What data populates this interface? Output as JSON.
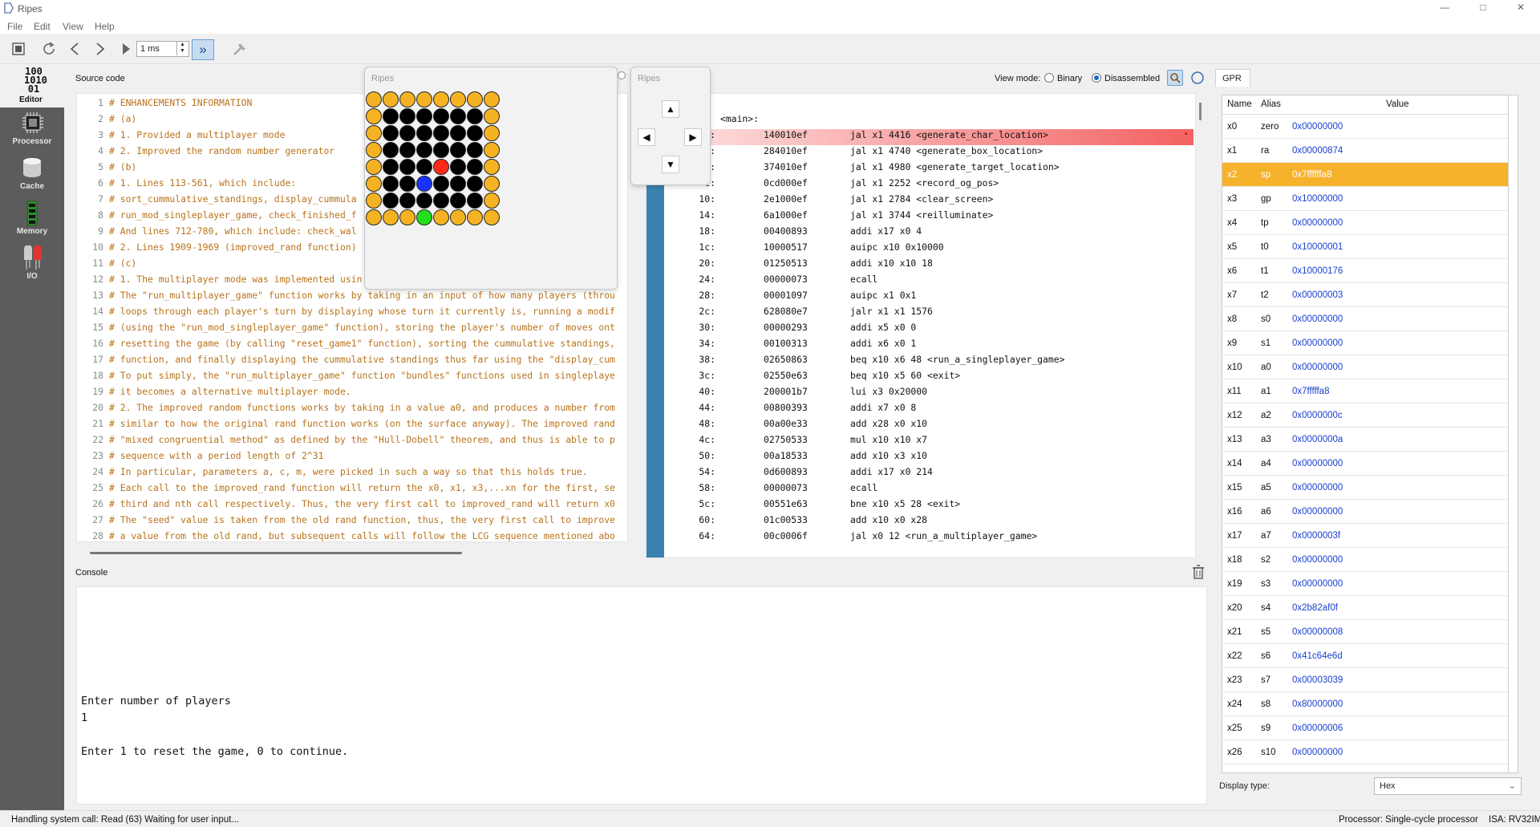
{
  "window": {
    "title": "Ripes",
    "minimize": "—",
    "maximize": "□",
    "close": "✕"
  },
  "menu": [
    "File",
    "Edit",
    "View",
    "Help"
  ],
  "toolbar": {
    "speed_value": "1 ms"
  },
  "sidebar": [
    {
      "label": "Editor",
      "icon": "editor-icon"
    },
    {
      "label": "Processor",
      "icon": "processor-icon"
    },
    {
      "label": "Cache",
      "icon": "cache-icon"
    },
    {
      "label": "Memory",
      "icon": "memory-icon"
    },
    {
      "label": "I/O",
      "icon": "io-icon"
    }
  ],
  "editor_icon_text": [
    "100",
    "1010",
    "01"
  ],
  "source_code": {
    "label": "Source code",
    "lines": [
      "# ENHANCEMENTS INFORMATION",
      "# (a)",
      "# 1. Provided a multiplayer mode",
      "# 2. Improved the random number generator",
      "# (b)",
      "# 1. Lines 113-561, which include:",
      "#  sort_cummulative_standings, display_cummula",
      "#  run_mod_singleplayer_game, check_finished_f",
      "#  And lines 712-780, which include: check_wal",
      "# 2. Lines 1909-1969 (improved_rand function)",
      "# (c)",
      "# 1. The multiplayer mode was implemented usin",
      "# The \"run_multiplayer_game\" function works by taking in an input of how many players (throu",
      "# loops through each player's turn by displaying whose turn it currently is, running a modif",
      "# (using the \"run_mod_singleplayer_game\" function), storing the player's number of moves ont",
      "# resetting the game (by calling \"reset_game1\" function), sorting the cummulative standings,",
      "# function, and finally displaying the cummulative standings thus far using the \"display_cum",
      "# To put simply, the \"run_multiplayer_game\" function \"bundles\" functions used in singleplaye",
      "# it becomes a alternative multiplayer mode.",
      "# 2. The improved random functions works by taking in a value a0, and produces a number from",
      "# similar to how the original rand function works (on the surface anyway). The improved rand",
      "# \"mixed congruential method\" as defined by the \"Hull-Dobell\" theorem, and thus is able to p",
      "# sequence with a period length of 2^31",
      "# In particular, parameters a, c, m, were picked in such a way so that this holds true.",
      "# Each call to the improved_rand function will return the x0, x1, x3,...xn for the first, se",
      "# third and nth call respectively. Thus, the very first call to improved_rand will return x0",
      "# The \"seed\" value is taken from the old rand function, thus, the very first call to improve",
      "# a value from the old rand, but subsequent calls will follow the LCG sequence mentioned abo"
    ]
  },
  "view_mode": {
    "label": "View mode:",
    "options": [
      "Binary",
      "Disassembled"
    ],
    "selected": "Disassembled"
  },
  "disassembly": {
    "header": "<main>:",
    "rows": [
      {
        "addr": "0:",
        "hex": "140010ef",
        "ins": "jal x1 4416 <generate_char_location>"
      },
      {
        "addr": "4:",
        "hex": "284010ef",
        "ins": "jal x1 4740 <generate_box_location>"
      },
      {
        "addr": "8:",
        "hex": "374010ef",
        "ins": "jal x1 4980 <generate_target_location>"
      },
      {
        "addr": "c:",
        "hex": "0cd000ef",
        "ins": "jal x1 2252 <record_og_pos>"
      },
      {
        "addr": "10:",
        "hex": "2e1000ef",
        "ins": "jal x1 2784 <clear_screen>"
      },
      {
        "addr": "14:",
        "hex": "6a1000ef",
        "ins": "jal x1 3744 <reilluminate>"
      },
      {
        "addr": "18:",
        "hex": "00400893",
        "ins": "addi x17 x0 4"
      },
      {
        "addr": "1c:",
        "hex": "10000517",
        "ins": "auipc x10 0x10000"
      },
      {
        "addr": "20:",
        "hex": "01250513",
        "ins": "addi x10 x10 18"
      },
      {
        "addr": "24:",
        "hex": "00000073",
        "ins": "ecall"
      },
      {
        "addr": "28:",
        "hex": "00001097",
        "ins": "auipc x1 0x1"
      },
      {
        "addr": "2c:",
        "hex": "628080e7",
        "ins": "jalr x1 x1 1576"
      },
      {
        "addr": "30:",
        "hex": "00000293",
        "ins": "addi x5 x0 0"
      },
      {
        "addr": "34:",
        "hex": "00100313",
        "ins": "addi x6 x0 1"
      },
      {
        "addr": "38:",
        "hex": "02650863",
        "ins": "beq x10 x6 48 <run_a_singleplayer_game>"
      },
      {
        "addr": "3c:",
        "hex": "02550e63",
        "ins": "beq x10 x5 60 <exit>"
      },
      {
        "addr": "40:",
        "hex": "200001b7",
        "ins": "lui x3 0x20000"
      },
      {
        "addr": "44:",
        "hex": "00800393",
        "ins": "addi x7 x0 8"
      },
      {
        "addr": "48:",
        "hex": "00a00e33",
        "ins": "add x28 x0 x10"
      },
      {
        "addr": "4c:",
        "hex": "02750533",
        "ins": "mul x10 x10 x7"
      },
      {
        "addr": "50:",
        "hex": "00a18533",
        "ins": "add x10 x3 x10"
      },
      {
        "addr": "54:",
        "hex": "0d600893",
        "ins": "addi x17 x0 214"
      },
      {
        "addr": "58:",
        "hex": "00000073",
        "ins": "ecall"
      },
      {
        "addr": "5c:",
        "hex": "00551e63",
        "ins": "bne x10 x5 28 <exit>"
      },
      {
        "addr": "60:",
        "hex": "01c00533",
        "ins": "add x10 x0 x28"
      },
      {
        "addr": "64:",
        "hex": "00c0006f",
        "ins": "jal x0 12 <run_a_multiplayer_game>"
      }
    ]
  },
  "console": {
    "label": "Console",
    "lines": [
      "Enter number of players",
      "1",
      "",
      "Enter 1 to reset the game, 0 to continue."
    ]
  },
  "gpr": {
    "tab": "GPR",
    "columns": [
      "Name",
      "Alias",
      "Value"
    ],
    "selected": "x2",
    "rows": [
      {
        "name": "x0",
        "alias": "zero",
        "value": "0x00000000"
      },
      {
        "name": "x1",
        "alias": "ra",
        "value": "0x00000874"
      },
      {
        "name": "x2",
        "alias": "sp",
        "value": "0x7ffffffa8"
      },
      {
        "name": "x3",
        "alias": "gp",
        "value": "0x10000000"
      },
      {
        "name": "x4",
        "alias": "tp",
        "value": "0x00000000"
      },
      {
        "name": "x5",
        "alias": "t0",
        "value": "0x10000001"
      },
      {
        "name": "x6",
        "alias": "t1",
        "value": "0x10000176"
      },
      {
        "name": "x7",
        "alias": "t2",
        "value": "0x00000003"
      },
      {
        "name": "x8",
        "alias": "s0",
        "value": "0x00000000"
      },
      {
        "name": "x9",
        "alias": "s1",
        "value": "0x00000000"
      },
      {
        "name": "x10",
        "alias": "a0",
        "value": "0x00000000"
      },
      {
        "name": "x11",
        "alias": "a1",
        "value": "0x7fffffa8"
      },
      {
        "name": "x12",
        "alias": "a2",
        "value": "0x0000000c"
      },
      {
        "name": "x13",
        "alias": "a3",
        "value": "0x0000000a"
      },
      {
        "name": "x14",
        "alias": "a4",
        "value": "0x00000000"
      },
      {
        "name": "x15",
        "alias": "a5",
        "value": "0x00000000"
      },
      {
        "name": "x16",
        "alias": "a6",
        "value": "0x00000000"
      },
      {
        "name": "x17",
        "alias": "a7",
        "value": "0x0000003f"
      },
      {
        "name": "x18",
        "alias": "s2",
        "value": "0x00000000"
      },
      {
        "name": "x19",
        "alias": "s3",
        "value": "0x00000000"
      },
      {
        "name": "x20",
        "alias": "s4",
        "value": "0x2b82af0f"
      },
      {
        "name": "x21",
        "alias": "s5",
        "value": "0x00000008"
      },
      {
        "name": "x22",
        "alias": "s6",
        "value": "0x41c64e6d"
      },
      {
        "name": "x23",
        "alias": "s7",
        "value": "0x00003039"
      },
      {
        "name": "x24",
        "alias": "s8",
        "value": "0x80000000"
      },
      {
        "name": "x25",
        "alias": "s9",
        "value": "0x00000006"
      },
      {
        "name": "x26",
        "alias": "s10",
        "value": "0x00000000"
      }
    ],
    "display_type_label": "Display type:",
    "display_type_value": "Hex"
  },
  "led_window": {
    "title": "Ripes",
    "size": 8,
    "colors": {
      "border": "#f5b324",
      "off": "#000000",
      "red": "#ff2a1a",
      "blue": "#1a32ff",
      "green": "#24e01c"
    },
    "special": [
      {
        "row": 4,
        "col": 4,
        "color": "red"
      },
      {
        "row": 5,
        "col": 3,
        "color": "blue"
      },
      {
        "row": 7,
        "col": 3,
        "color": "green"
      }
    ]
  },
  "dpad_window": {
    "title": "Ripes",
    "up": "▲",
    "left": "◀",
    "right": "▶",
    "down": "▼"
  },
  "status": {
    "left": "Handling system call: Read (63)  Waiting for user input...",
    "processor": "Processor: Single-cycle processor",
    "isa": "ISA: RV32IM"
  },
  "colors": {
    "sidebar": "#5c5c5c",
    "asm_gutter": "#3b82b1",
    "reg_highlight": "#f7b22c",
    "reg_value": "#1a3fd0",
    "comment": "#b8731c"
  }
}
